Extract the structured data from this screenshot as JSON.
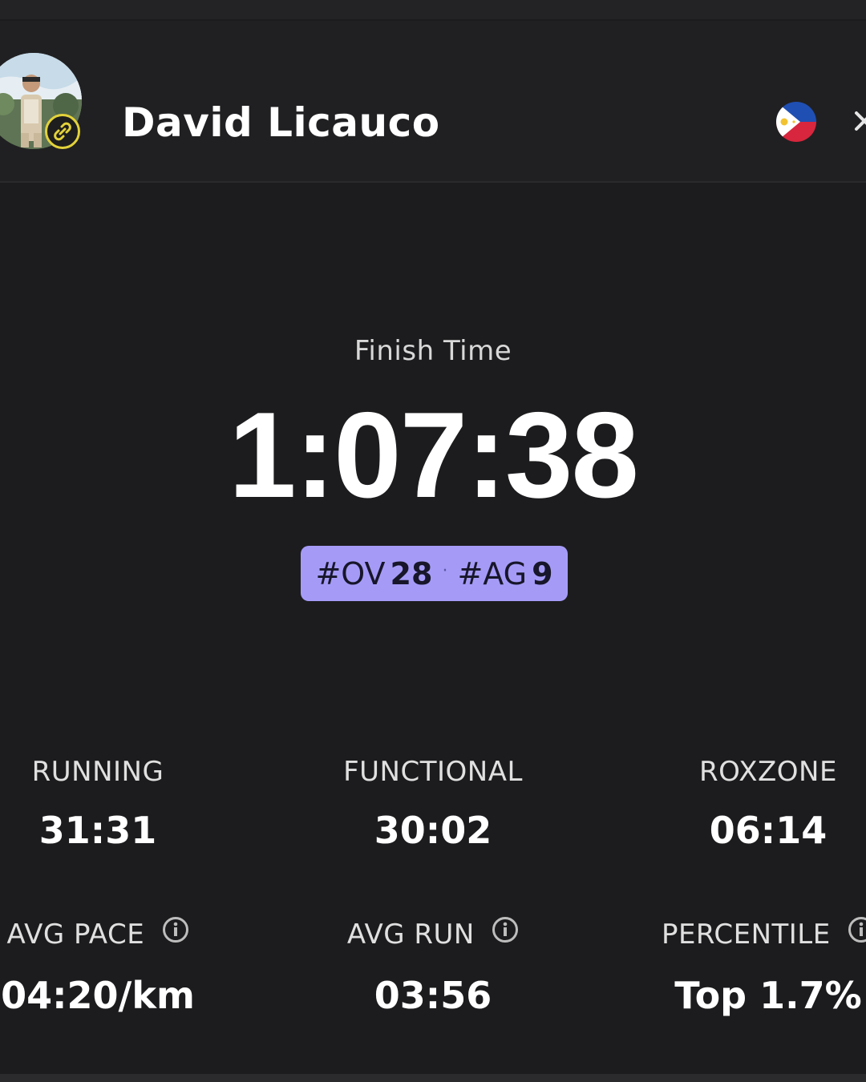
{
  "athlete": {
    "name": "David Licauco",
    "avatar_badge_icon": "link-icon",
    "country_flag": "philippines-flag-icon"
  },
  "header": {
    "close_icon": "close-icon"
  },
  "result": {
    "finish_label": "Finish Time",
    "finish_time": "1:07:38",
    "overall_prefix": "#OV",
    "overall_rank": "28",
    "separator": "·",
    "age_group_prefix": "#AG",
    "age_group_rank": "9",
    "pill_color": "#a59bf7"
  },
  "splits": [
    {
      "label": "RUNNING",
      "value": "31:31"
    },
    {
      "label": "FUNCTIONAL",
      "value": "30:02"
    },
    {
      "label": "ROXZONE",
      "value": "06:14"
    }
  ],
  "metrics": [
    {
      "label": "AVG PACE",
      "value": "04:20/km",
      "icon": "info-icon"
    },
    {
      "label": "AVG RUN",
      "value": "03:56",
      "icon": "info-icon"
    },
    {
      "label": "PERCENTILE",
      "value": "Top 1.7%",
      "icon": "info-icon"
    }
  ]
}
